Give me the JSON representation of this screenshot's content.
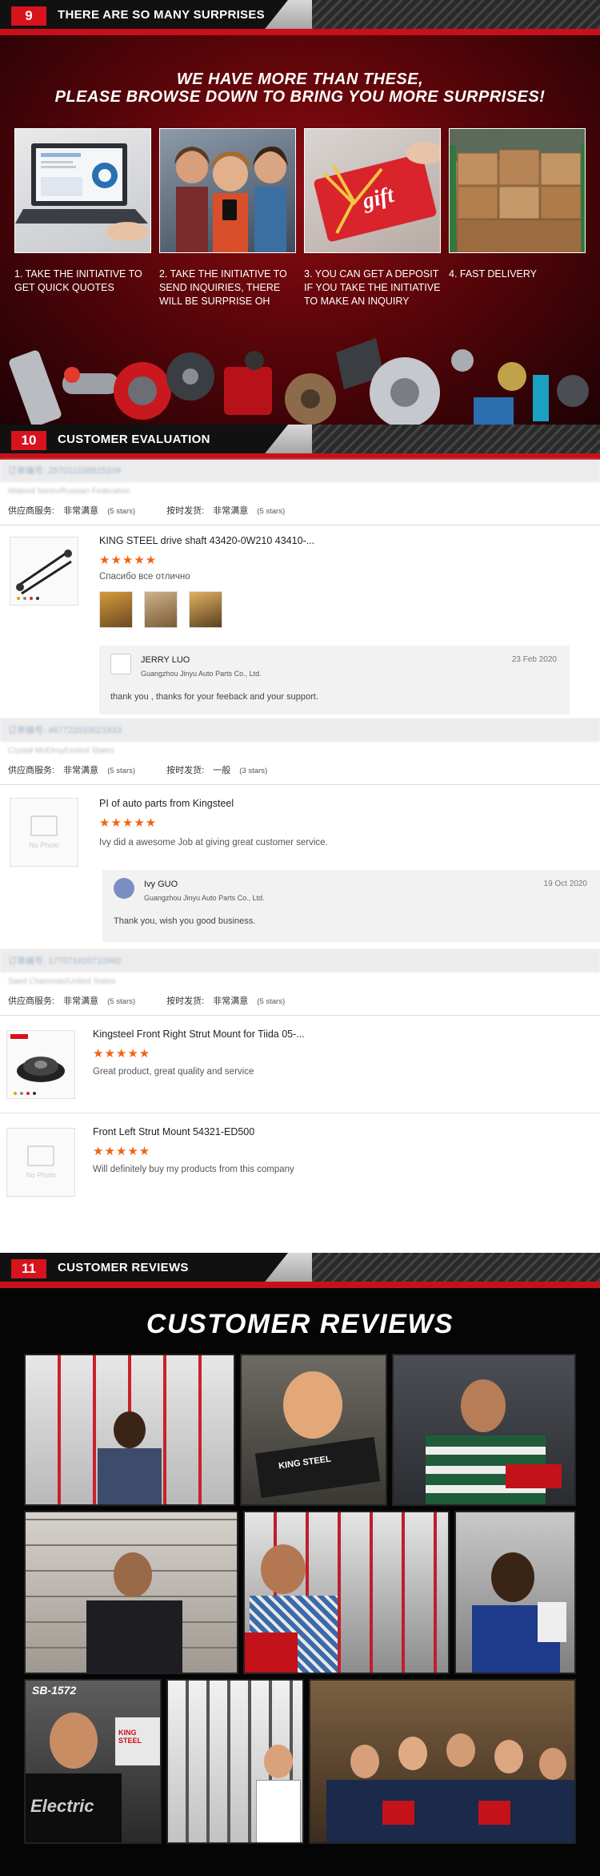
{
  "section9": {
    "number": "9",
    "title": "THERE ARE SO MANY SURPRISES",
    "headline_line1": "WE HAVE MORE THAN THESE,",
    "headline_line2": "PLEASE BROWSE DOWN TO BRING YOU MORE SURPRISES!",
    "gift_card_text": "gift",
    "steps": [
      {
        "caption": "1. TAKE THE INITIATIVE TO GET QUICK QUOTES"
      },
      {
        "caption": "2. TAKE THE INITIATIVE TO SEND INQUIRIES, THERE WILL BE SURPRISE OH"
      },
      {
        "caption": "3. YOU CAN GET A DEPOSIT IF YOU TAKE THE INITIATIVE TO MAKE AN INQUIRY"
      },
      {
        "caption": "4. FAST DELIVERY"
      }
    ]
  },
  "section10": {
    "number": "10",
    "title": "CUSTOMER EVALUATION",
    "orders": [
      {
        "order_label": "订单编号:",
        "order_id": "257011038815209",
        "buyer": "Waleed Seren/Russian Federation",
        "service_label": "供应商服务:",
        "service_value": "非常满意",
        "service_stars": "(5 stars)",
        "shipping_label": "按时发货:",
        "shipping_value": "非常满意",
        "shipping_stars": "(5 stars)",
        "reviews": [
          {
            "title": "KING STEEL drive shaft 43420-0W210 43410-...",
            "stars": "★★★★★",
            "comment": "Спасибо     все отлично",
            "reply": {
              "name": "JERRY LUO",
              "company": "Guangzhou Jinyu Auto Parts Co., Ltd.",
              "date": "23 Feb 2020",
              "text": "thank you , thanks for your feeback and your support."
            }
          }
        ]
      },
      {
        "order_label": "订单编号:",
        "order_id": "467722033021833",
        "buyer": "Crystal McElroy/United States",
        "service_label": "供应商服务:",
        "service_value": "非常满意",
        "service_stars": "(5 stars)",
        "shipping_label": "按时发货:",
        "shipping_value": "一般",
        "shipping_stars": "(3 stars)",
        "reviews": [
          {
            "title": "PI of auto parts from Kingsteel",
            "stars": "★★★★★",
            "comment": "Ivy did a awesome Job at giving great customer service.",
            "no_photo": "No Photo",
            "reply": {
              "name": "Ivy GUO",
              "company": "Guangzhou Jinyu Auto Parts Co., Ltd.",
              "date": "19 Oct 2020",
              "text": "Thank you, wish you good business."
            }
          }
        ]
      },
      {
        "order_label": "订单编号:",
        "order_id": "177071620710992",
        "buyer": "Saed Chammas/United States",
        "service_label": "供应商服务:",
        "service_value": "非常满意",
        "service_stars": "(5 stars)",
        "shipping_label": "按时发货:",
        "shipping_value": "非常满意",
        "shipping_stars": "(5 stars)",
        "reviews": [
          {
            "title": "Kingsteel Front Right Strut Mount for Tiida 05-...",
            "stars": "★★★★★",
            "comment": "Great product, great quality and service"
          },
          {
            "title": "Front Left Strut Mount 54321-ED500",
            "stars": "★★★★★",
            "comment": "Will definitely buy my products from this company",
            "no_photo": "No Photo"
          }
        ]
      }
    ]
  },
  "section11": {
    "number": "11",
    "title": "CUSTOMER REVIEWS",
    "headline": "CUSTOMER REVIEWS",
    "photo_labels": {
      "sb": "SB-1572",
      "box1": "KING STEEL",
      "box2": "KING STEEL",
      "shirt": "Electric"
    }
  },
  "colors": {
    "accent_red": "#d7131d",
    "star_orange": "#f06414"
  }
}
